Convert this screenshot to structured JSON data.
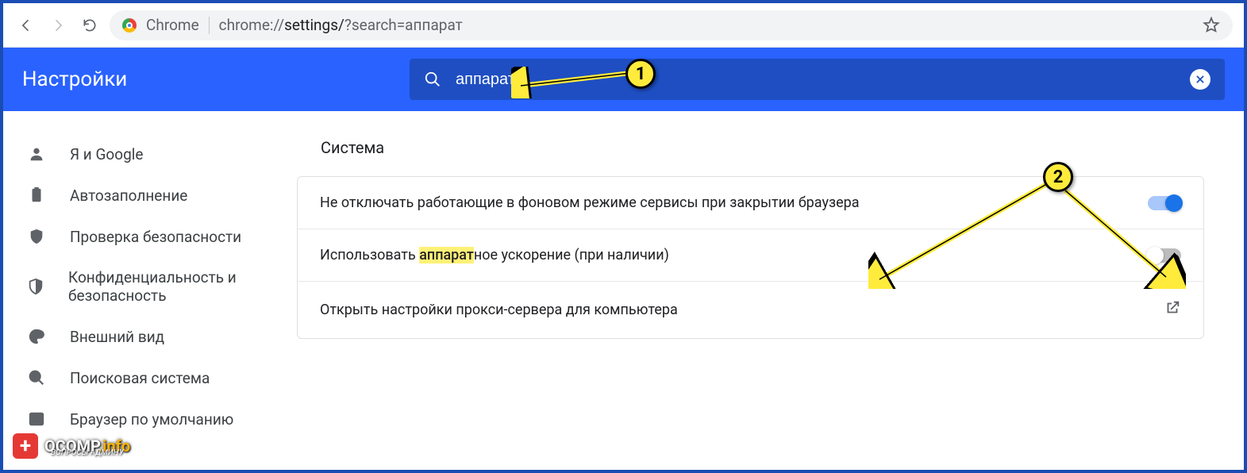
{
  "browser": {
    "label": "Chrome",
    "url_prefix": "chrome://",
    "url_path": "settings/",
    "url_query": "?search=аппарат"
  },
  "header": {
    "title": "Настройки",
    "search_value": "аппарат"
  },
  "sidebar": {
    "items": [
      {
        "label": "Я и Google"
      },
      {
        "label": "Автозаполнение"
      },
      {
        "label": "Проверка безопасности"
      },
      {
        "label": "Конфиденциальность и безопасность"
      },
      {
        "label": "Внешний вид"
      },
      {
        "label": "Поисковая система"
      },
      {
        "label": "Браузер по умолчанию"
      }
    ]
  },
  "main": {
    "section_title": "Система",
    "rows": {
      "bg_apps": "Не отключать работающие в фоновом режиме сервисы при закрытии браузера",
      "hw_pre": "Использовать ",
      "hw_hl": "аппарат",
      "hw_post": "ное ускорение (при наличии)",
      "proxy": "Открыть настройки прокси-сервера для компьютера"
    },
    "toggles": {
      "bg_apps": true,
      "hw_accel": false
    }
  },
  "annotations": {
    "badge1": "1",
    "badge2": "2"
  },
  "watermark": {
    "main": "OCOMP",
    "suffix": ".info",
    "sub": "ВОПРОСЫ АДМИНУ"
  }
}
